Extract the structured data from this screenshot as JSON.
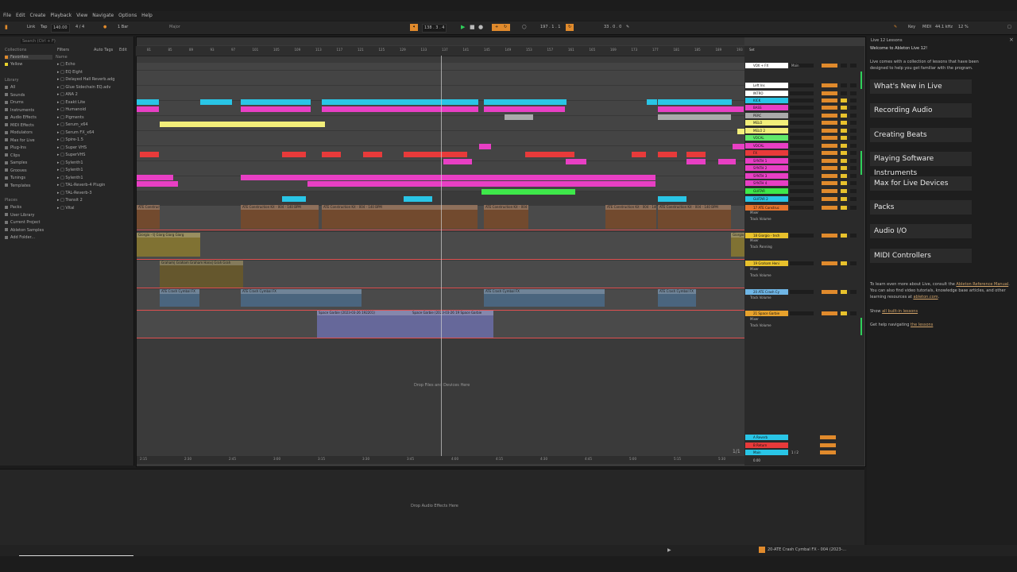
{
  "menu": [
    "File",
    "Edit",
    "Create",
    "Playback",
    "View",
    "Navigate",
    "Options",
    "Help"
  ],
  "transport": {
    "link": "Link",
    "tap": "Tap",
    "tempo": "140.00",
    "sig": "4 / 4",
    "quant": "1 Bar",
    "scale": "Major",
    "pos": "138 . 3 . 4",
    "loop_start": "197 . 1 . 1",
    "loop_len": "33 . 0 . 0",
    "key": "Key",
    "midi": "MIDI",
    "sample_rate": "44.1 kHz",
    "cpu": "12 %"
  },
  "browser": {
    "search_placeholder": "Search (Ctrl + F)",
    "filters": "Filters",
    "auto_tags": "Auto Tags",
    "edit": "Edit",
    "collections_title": "Collections",
    "collections": [
      "Favorites",
      "Yellow"
    ],
    "library_title": "Library",
    "library": [
      "All",
      "Sounds",
      "Drums",
      "Instruments",
      "Audio Effects",
      "MIDI Effects",
      "Modulators",
      "Max for Live",
      "Plug-Ins",
      "Clips",
      "Samples",
      "Grooves",
      "Tunings",
      "Templates"
    ],
    "places_title": "Places",
    "places": [
      "Packs",
      "User Library",
      "Current Project",
      "Ableton Samples",
      "Add Folder..."
    ],
    "name_header": "Name",
    "items": [
      "Echo",
      "EQ Eight",
      "Delayed Hall Reverb.adg",
      "Glue Sidechain EQ.adv",
      "ANA 2",
      "Exakt Lite",
      "Humanoid",
      "Pigments",
      "Serum_x64",
      "Serum FX_x64",
      "Spire-1.5",
      "Super VHS",
      "SuperVHS",
      "Sylenth1",
      "Sylenth1",
      "Sylenth1",
      "TAL-Reverb-4 Plugin",
      "TAL-Reverb-3",
      "Transit 2",
      "Vital"
    ]
  },
  "ruler": [
    "81",
    "85",
    "89",
    "93",
    "97",
    "101",
    "105",
    "109",
    "113",
    "117",
    "121",
    "125",
    "129",
    "133",
    "137",
    "141",
    "145",
    "149",
    "153",
    "157",
    "161",
    "165",
    "169",
    "173",
    "177",
    "181",
    "185",
    "189",
    "193",
    "197"
  ],
  "timeline": [
    "2:15",
    "2:30",
    "2:45",
    "3:00",
    "3:15",
    "3:30",
    "3:45",
    "4:00",
    "4:15",
    "4:30",
    "4:45",
    "5:00",
    "5:15",
    "5:30"
  ],
  "tracks": [
    {
      "name": "VOX + FX",
      "color": "#ffffff"
    },
    {
      "name": "Left Ins",
      "color": "#ffffff"
    },
    {
      "name": "INTRO",
      "color": "#ffffff"
    },
    {
      "name": "KICK",
      "color": "#29c5e6"
    },
    {
      "name": "BASS",
      "color": "#e83fc4"
    },
    {
      "name": "PERC",
      "color": "#aaaaaa"
    },
    {
      "name": "MELO",
      "color": "#f2ee7a"
    },
    {
      "name": "MELO 2",
      "color": "#f2ee7a"
    },
    {
      "name": "VOCAL",
      "color": "#62e86a"
    },
    {
      "name": "VOCAL",
      "color": "#e83fc4"
    },
    {
      "name": "FX",
      "color": "#e83a3a"
    },
    {
      "name": "SYNTH 1",
      "color": "#e83fc4"
    },
    {
      "name": "SYNTH 2",
      "color": "#e83fc4"
    },
    {
      "name": "SYNTH 3",
      "color": "#e83fc4"
    },
    {
      "name": "SYNTH 4",
      "color": "#e83fc4"
    },
    {
      "name": "GUITAR",
      "color": "#3ee84a"
    },
    {
      "name": "GUITAR 2",
      "color": "#29c5e6"
    },
    {
      "name": "17 ATE Construc",
      "color": "#e8742c"
    },
    {
      "name": "18 Giorgio - tech",
      "color": "#e8c12c"
    },
    {
      "name": "19 Graham Heni",
      "color": "#e8c12c"
    },
    {
      "name": "20 ATE Crash Cy",
      "color": "#6fb6e6"
    },
    {
      "name": "21 Space Garbie",
      "color": "#e8a22c"
    }
  ],
  "clip_labels": {
    "construction": "ATE Construction Kit - 004 - 140 BPM",
    "giorgio": "Giorgio - t| Giorg Giorg Giorg",
    "graham": "Graham| Graham Graham Hanx| Grah Grah",
    "crash": "ATE Crash Cymbal FX",
    "space": "Space Garbie (2023-03-26 192201)",
    "space2": "Space Garbie (2023-03-26 19 Space Garbie"
  },
  "mixer": {
    "set": "Set",
    "main": "Main",
    "mixer": "Mixer",
    "auto": "Auto",
    "track_volume": "Track Volume",
    "track_panning": "Track Panning",
    "returns": [
      "A Reverb",
      "B Return",
      "Main"
    ],
    "main_val": "1 / 2",
    "db": "0.00"
  },
  "drop_files": "Drop Files and Devices Here",
  "drop_audio": "Drop Audio Effects Here",
  "status_clip": "20-ATE Crash Cymbal FX - 004 (2023-...",
  "page_indicator": "1/1",
  "help": {
    "header": "Live 12 Lessons",
    "title": "Welcome to Ableton Live 12!",
    "intro": "Live comes with a collection of lessons that have been designed to help you get familiar with the program.",
    "lessons": [
      "What's New in Live",
      "Recording Audio",
      "Creating Beats",
      "Playing Software Instruments",
      "Max for Live Devices",
      "Packs",
      "Audio I/O",
      "MIDI Controllers"
    ],
    "learn_more": "To learn even more about Live, consult the",
    "manual_link": "Ableton Reference Manual",
    "learn_more2": ". You can also find video tutorials, knowledge base articles, and other learning resources at",
    "site_link": "ableton.com",
    "show_all_pre": "Show",
    "show_all_link": "all built-in lessons",
    "help_pre": "Get help navigating",
    "help_link": "the lessons"
  },
  "colors": {
    "accent": "#e08a2c",
    "kick": "#29c5e6",
    "bass": "#e83fc4",
    "melo": "#f2ee7a",
    "fx": "#e83a3a",
    "guitar": "#3ee84a",
    "audio": "#e8742c"
  }
}
